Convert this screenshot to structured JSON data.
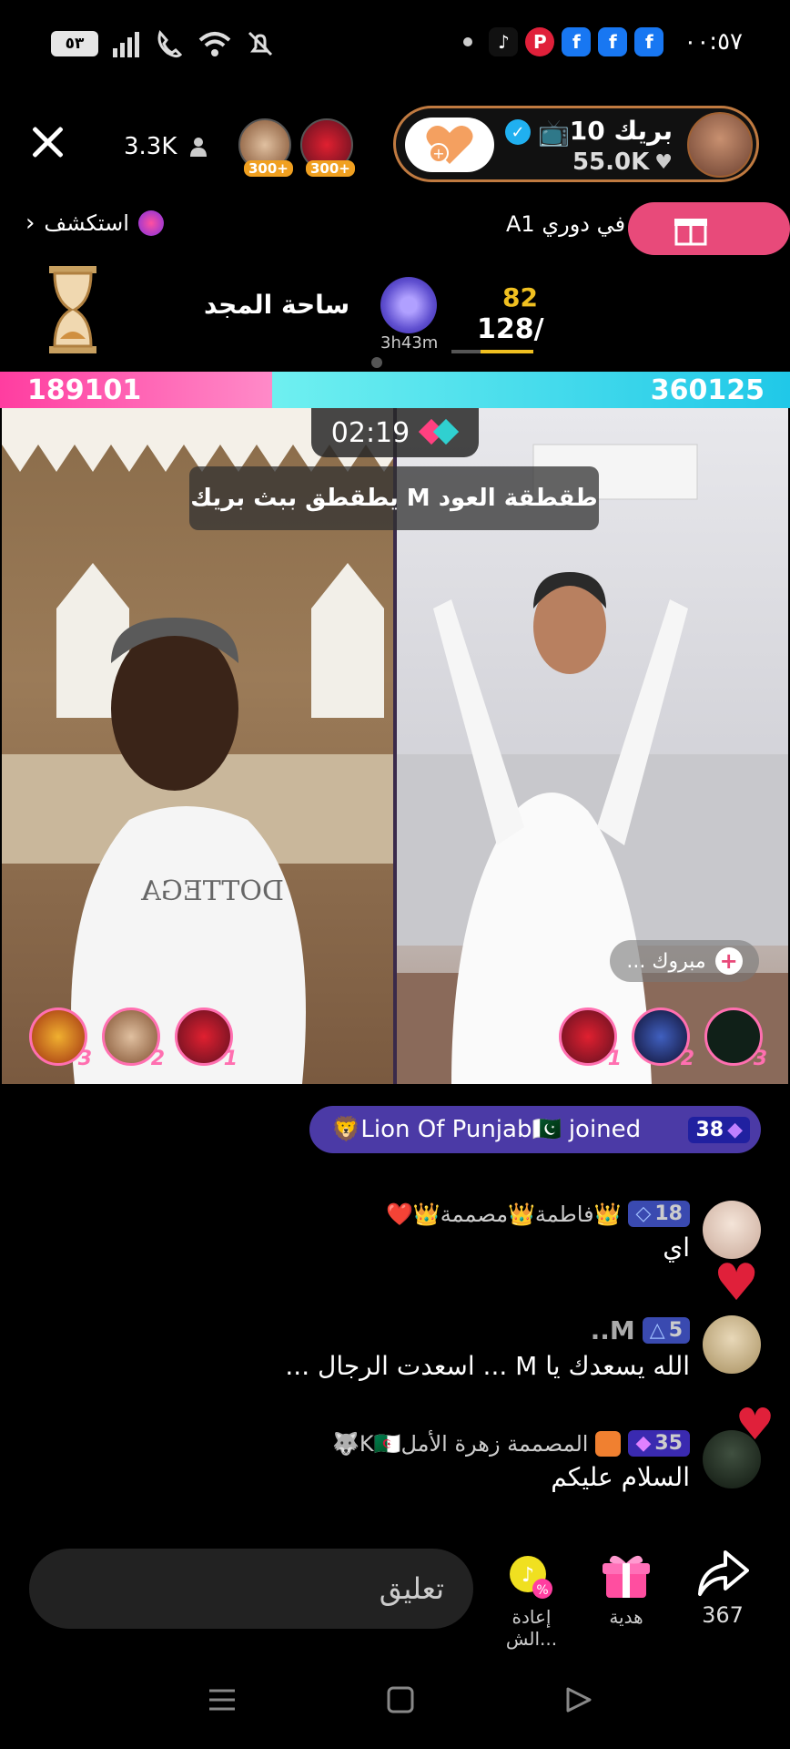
{
  "status": {
    "battery": "٥٣",
    "time": "٠٠:٥٧"
  },
  "top": {
    "viewer_count": "3.3K",
    "top_gifter_badges": [
      "300+",
      "300+"
    ],
    "host_name": "بريك 10",
    "host_likes": "55.0K",
    "explore_label": "استكشف",
    "league_text": "في دوري A1",
    "glory_title": "ساحة المجد",
    "target_time": "3h43m",
    "score_current": "82",
    "score_total": "128/",
    "score_progress": 0.64
  },
  "battle": {
    "left_score": "189101",
    "right_score": "360125",
    "timer": "02:19",
    "banner": "طقطقة العود M يطقطق ببث بريك",
    "congrats": "مبروك ...",
    "left_ranks": [
      "3",
      "2",
      "1"
    ],
    "right_ranks": [
      "1",
      "2",
      "3"
    ]
  },
  "chat": {
    "joined_user": "🦁Lion Of Punjab🇵🇰",
    "joined_label": "joined",
    "joined_level": "38",
    "messages": [
      {
        "name": "👑فاطمة👑مصممة👑❤️",
        "level": "18",
        "text": "اي"
      },
      {
        "name": "M..",
        "level": "5",
        "text": "الله يسعدك يا M ...  اسعدت الرجال ..."
      },
      {
        "name": "المصممة زهرة الأملK🇩🇿🐺",
        "level": "35",
        "text": "السلام عليكم"
      }
    ]
  },
  "bottom": {
    "comment_placeholder": "تعليق",
    "reshare_label": "إعادة الش...",
    "gift_label": "هدية",
    "share_count": "367"
  },
  "colors": {
    "accent_pink": "#ff3da0",
    "accent_cyan": "#20c8e8",
    "gift_pill": "#e84a7a",
    "joined_bg": "#4b3aa6"
  }
}
